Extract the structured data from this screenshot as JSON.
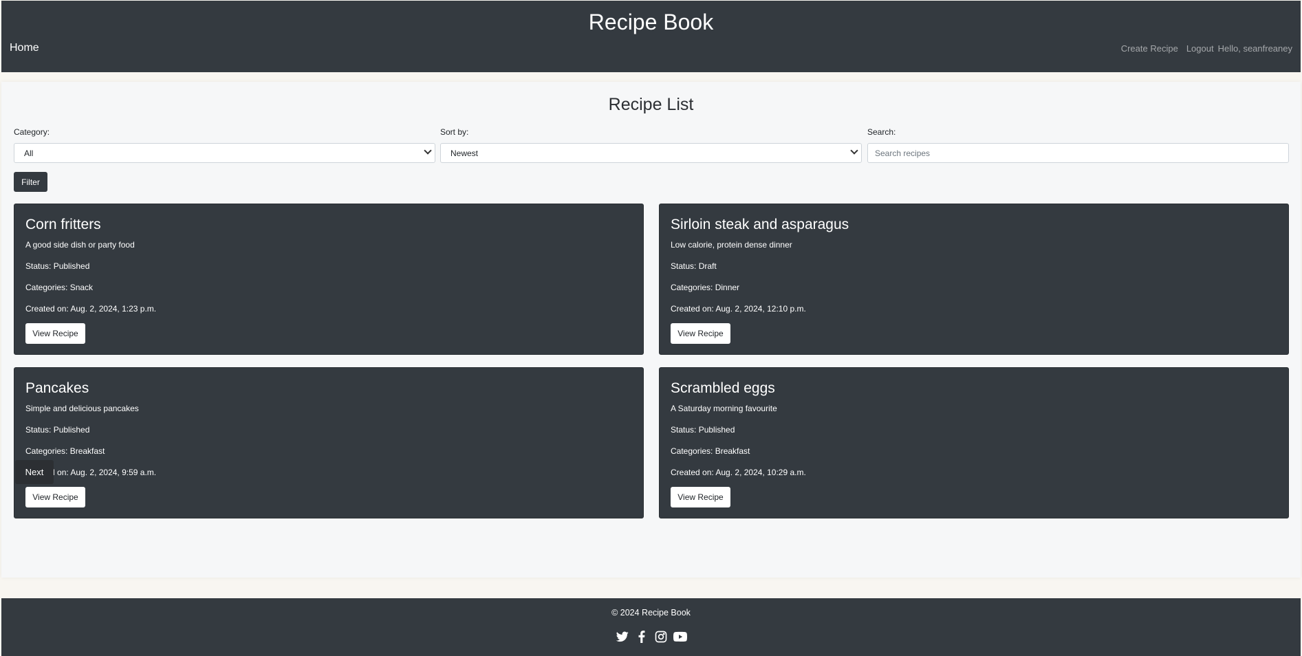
{
  "header": {
    "title": "Recipe Book",
    "home_label": "Home",
    "create_label": "Create Recipe",
    "logout_label": "Logout",
    "greeting": "Hello, seanfreaney"
  },
  "main": {
    "title": "Recipe List",
    "filters": {
      "category_label": "Category:",
      "category_value": "All",
      "sort_label": "Sort by:",
      "sort_value": "Newest",
      "search_label": "Search:",
      "search_placeholder": "Search recipes",
      "filter_button": "Filter"
    },
    "recipes": [
      {
        "title": "Corn fritters",
        "description": "A good side dish or party food",
        "status": "Status: Published",
        "categories": "Categories: Snack",
        "created": "Created on: Aug. 2, 2024, 1:23 p.m.",
        "button": "View Recipe"
      },
      {
        "title": "Sirloin steak and asparagus",
        "description": "Low calorie, protein dense dinner",
        "status": "Status: Draft",
        "categories": "Categories: Dinner",
        "created": "Created on: Aug. 2, 2024, 12:10 p.m.",
        "button": "View Recipe"
      },
      {
        "title": "Pancakes",
        "description": "Simple and delicious pancakes",
        "status": "Status: Published",
        "categories": "Categories: Breakfast",
        "created": "Created on: Aug. 2, 2024, 9:59 a.m.",
        "button": "View Recipe"
      },
      {
        "title": "Scrambled eggs",
        "description": "A Saturday morning favourite",
        "status": "Status: Published",
        "categories": "Categories: Breakfast",
        "created": "Created on: Aug. 2, 2024, 10:29 a.m.",
        "button": "View Recipe"
      }
    ],
    "next_label": "Next"
  },
  "footer": {
    "copyright": "© 2024 Recipe Book",
    "socials": [
      "twitter-icon",
      "facebook-icon",
      "instagram-icon",
      "youtube-icon"
    ]
  }
}
